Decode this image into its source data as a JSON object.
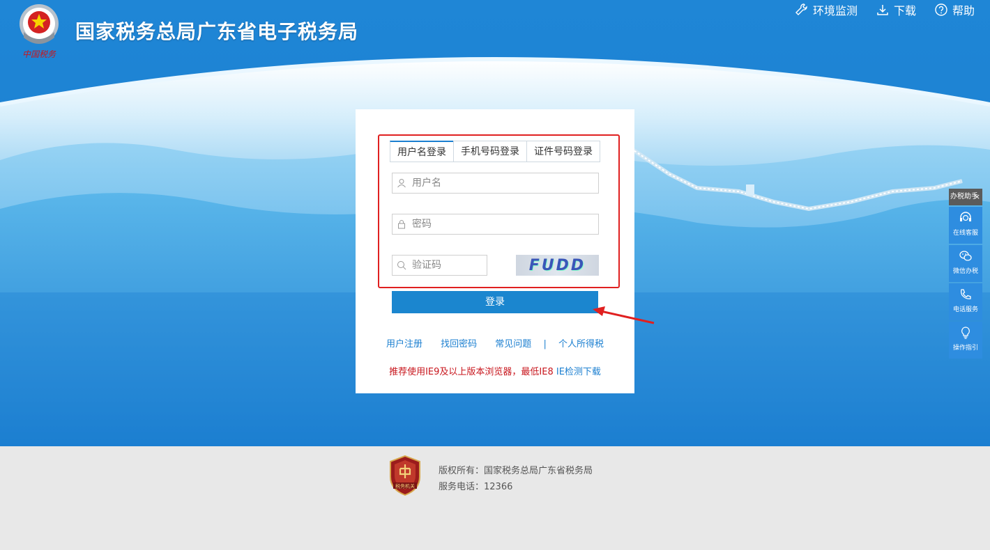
{
  "header": {
    "title": "国家税务总局广东省电子税务局",
    "emblem_caption": "中国税务",
    "links": [
      {
        "label": "环境监测",
        "icon": "wrench-icon"
      },
      {
        "label": "下载",
        "icon": "download-icon"
      },
      {
        "label": "帮助",
        "icon": "help-icon"
      }
    ]
  },
  "login": {
    "tabs": [
      "用户名登录",
      "手机号码登录",
      "证件号码登录"
    ],
    "active_tab": 0,
    "username_placeholder": "用户名",
    "password_placeholder": "密码",
    "captcha_placeholder": "验证码",
    "captcha_text": "FUDD",
    "submit_label": "登录",
    "links": [
      "用户注册",
      "找回密码",
      "常见问题"
    ],
    "separator": "|",
    "extra_link": "个人所得税",
    "notice_text": "推荐使用IE9及以上版本浏览器，最低IE8",
    "notice_link": "IE检测下载"
  },
  "side_panel": {
    "title": "办税助手",
    "close": "×",
    "items": [
      {
        "label": "在线客服",
        "icon": "customer-service-icon"
      },
      {
        "label": "微信办税",
        "icon": "wechat-icon"
      },
      {
        "label": "电话服务",
        "icon": "phone-icon"
      },
      {
        "label": "操作指引",
        "icon": "lightbulb-icon"
      }
    ]
  },
  "footer": {
    "badge_text": "税务机关",
    "copyright": "版权所有：国家税务总局广东省税务局",
    "phone": "服务电话：12366"
  },
  "colors": {
    "brand_blue": "#1b7fd0",
    "button_blue": "#1b86cf",
    "highlight_red": "#e02020",
    "notice_red": "#c8161d"
  }
}
